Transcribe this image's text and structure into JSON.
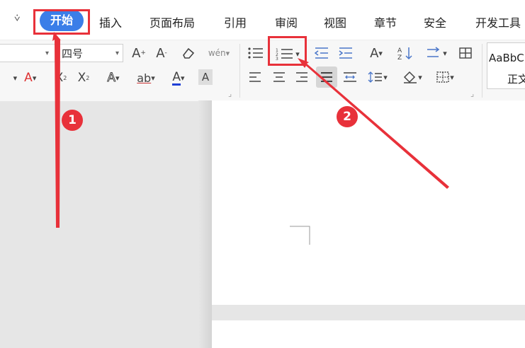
{
  "tabs": {
    "active": "开始",
    "items": [
      "插入",
      "页面布局",
      "引用",
      "审阅",
      "视图",
      "章节",
      "安全",
      "开发工具"
    ]
  },
  "font": {
    "size_value": "四号"
  },
  "styles": {
    "preview": "AaBbC",
    "label": "正文"
  },
  "annotations": {
    "badge1": "1",
    "badge2": "2",
    "color": "#e8313a"
  },
  "ribbon_glyphs": {
    "grow": "A",
    "shrink": "A",
    "phonetic": "wén",
    "superscript": "X",
    "subscript": "X",
    "font_color": "A",
    "char_shade": "A",
    "text_effect": "A",
    "char_border": "ab"
  }
}
